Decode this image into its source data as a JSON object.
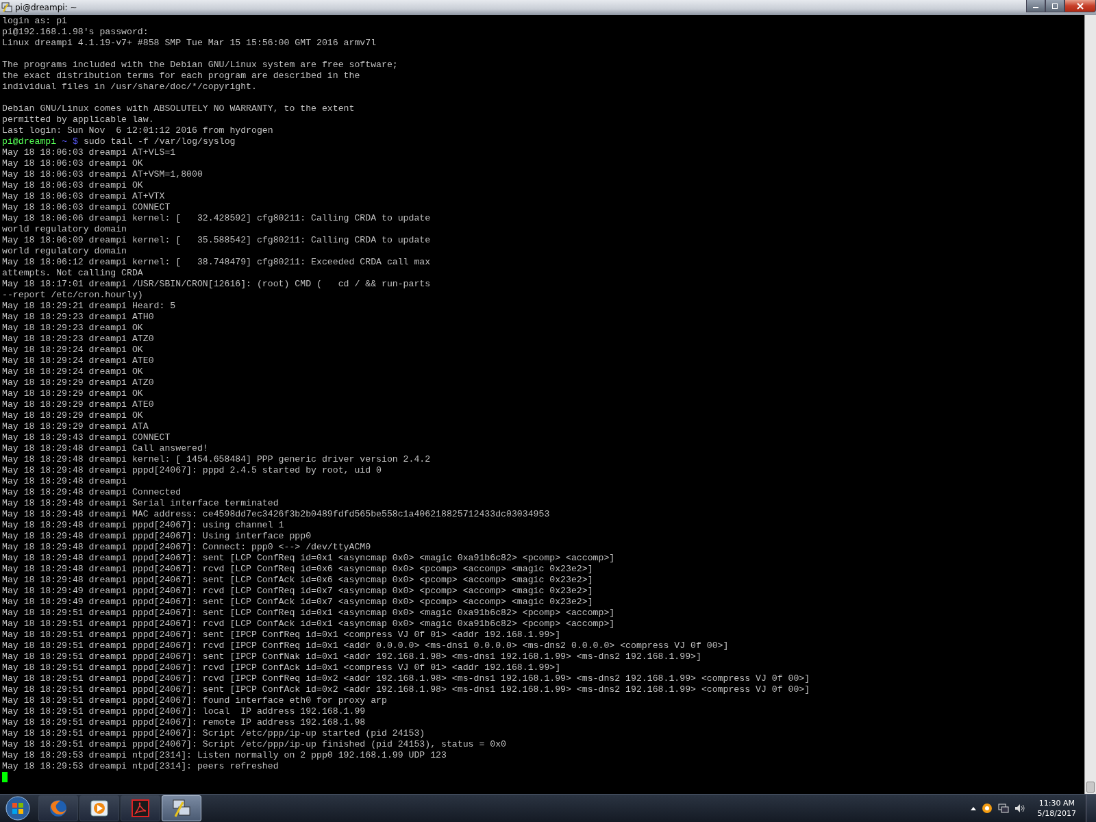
{
  "window": {
    "title": "pi@dreampi: ~"
  },
  "terminal": {
    "blocks": [
      {
        "lines": [
          {
            "kind": "output",
            "text": "login as: pi"
          },
          {
            "kind": "output",
            "text": "pi@192.168.1.98's password:"
          },
          {
            "kind": "output",
            "text": "Linux dreampi 4.1.19-v7+ #858 SMP Tue Mar 15 15:56:00 GMT 2016 armv7l"
          }
        ]
      },
      {
        "lines": [
          {
            "kind": "output",
            "text": "The programs included with the Debian GNU/Linux system are free software;"
          },
          {
            "kind": "output",
            "text": "the exact distribution terms for each program are described in the"
          },
          {
            "kind": "output",
            "text": "individual files in /usr/share/doc/*/copyright."
          }
        ]
      },
      {
        "lines": [
          {
            "kind": "output",
            "text": "Debian GNU/Linux comes with ABSOLUTELY NO WARRANTY, to the extent"
          },
          {
            "kind": "output",
            "text": "permitted by applicable law."
          },
          {
            "kind": "output",
            "text": "Last login: Sun Nov  6 12:01:12 2016 from hydrogen"
          },
          {
            "kind": "prompt",
            "user": "pi@dreampi",
            "path": "~ $",
            "text": "sudo tail -f /var/log/syslog"
          },
          {
            "kind": "output",
            "text": "May 18 18:06:03 dreampi AT+VLS=1"
          },
          {
            "kind": "output",
            "text": "May 18 18:06:03 dreampi OK"
          },
          {
            "kind": "output",
            "text": "May 18 18:06:03 dreampi AT+VSM=1,8000"
          },
          {
            "kind": "output",
            "text": "May 18 18:06:03 dreampi OK"
          },
          {
            "kind": "output",
            "text": "May 18 18:06:03 dreampi AT+VTX"
          },
          {
            "kind": "output",
            "text": "May 18 18:06:03 dreampi CONNECT"
          },
          {
            "kind": "output",
            "text": "May 18 18:06:06 dreampi kernel: [   32.428592] cfg80211: Calling CRDA to update"
          },
          {
            "kind": "output",
            "text": "world regulatory domain"
          },
          {
            "kind": "output",
            "text": "May 18 18:06:09 dreampi kernel: [   35.588542] cfg80211: Calling CRDA to update"
          },
          {
            "kind": "output",
            "text": "world regulatory domain"
          },
          {
            "kind": "output",
            "text": "May 18 18:06:12 dreampi kernel: [   38.748479] cfg80211: Exceeded CRDA call max"
          },
          {
            "kind": "output",
            "text": "attempts. Not calling CRDA"
          },
          {
            "kind": "output",
            "text": "May 18 18:17:01 dreampi /USR/SBIN/CRON[12616]: (root) CMD (   cd / && run-parts"
          },
          {
            "kind": "output",
            "text": "--report /etc/cron.hourly)"
          },
          {
            "kind": "output",
            "text": "May 18 18:29:21 dreampi Heard: 5"
          },
          {
            "kind": "output",
            "text": "May 18 18:29:23 dreampi ATH0"
          },
          {
            "kind": "output",
            "text": "May 18 18:29:23 dreampi OK"
          },
          {
            "kind": "output",
            "text": "May 18 18:29:23 dreampi ATZ0"
          },
          {
            "kind": "output",
            "text": "May 18 18:29:24 dreampi OK"
          },
          {
            "kind": "output",
            "text": "May 18 18:29:24 dreampi ATE0"
          },
          {
            "kind": "output",
            "text": "May 18 18:29:24 dreampi OK"
          },
          {
            "kind": "output",
            "text": "May 18 18:29:29 dreampi ATZ0"
          },
          {
            "kind": "output",
            "text": "May 18 18:29:29 dreampi OK"
          },
          {
            "kind": "output",
            "text": "May 18 18:29:29 dreampi ATE0"
          },
          {
            "kind": "output",
            "text": "May 18 18:29:29 dreampi OK"
          },
          {
            "kind": "output",
            "text": "May 18 18:29:29 dreampi ATA"
          },
          {
            "kind": "output",
            "text": "May 18 18:29:43 dreampi CONNECT"
          },
          {
            "kind": "output",
            "text": "May 18 18:29:48 dreampi Call answered!"
          },
          {
            "kind": "output",
            "text": "May 18 18:29:48 dreampi kernel: [ 1454.658484] PPP generic driver version 2.4.2"
          },
          {
            "kind": "output",
            "text": "May 18 18:29:48 dreampi pppd[24067]: pppd 2.4.5 started by root, uid 0"
          },
          {
            "kind": "output",
            "text": "May 18 18:29:48 dreampi"
          },
          {
            "kind": "output",
            "text": "May 18 18:29:48 dreampi Connected"
          },
          {
            "kind": "output",
            "text": "May 18 18:29:48 dreampi Serial interface terminated"
          },
          {
            "kind": "output",
            "text": "May 18 18:29:48 dreampi MAC address: ce4598dd7ec3426f3b2b0489fdfd565be558c1a406218825712433dc03034953"
          },
          {
            "kind": "output",
            "text": "May 18 18:29:48 dreampi pppd[24067]: using channel 1"
          },
          {
            "kind": "output",
            "text": "May 18 18:29:48 dreampi pppd[24067]: Using interface ppp0"
          },
          {
            "kind": "output",
            "text": "May 18 18:29:48 dreampi pppd[24067]: Connect: ppp0 <--> /dev/ttyACM0"
          },
          {
            "kind": "output",
            "text": "May 18 18:29:48 dreampi pppd[24067]: sent [LCP ConfReq id=0x1 <asyncmap 0x0> <magic 0xa91b6c82> <pcomp> <accomp>]"
          },
          {
            "kind": "output",
            "text": "May 18 18:29:48 dreampi pppd[24067]: rcvd [LCP ConfReq id=0x6 <asyncmap 0x0> <pcomp> <accomp> <magic 0x23e2>]"
          },
          {
            "kind": "output",
            "text": "May 18 18:29:48 dreampi pppd[24067]: sent [LCP ConfAck id=0x6 <asyncmap 0x0> <pcomp> <accomp> <magic 0x23e2>]"
          },
          {
            "kind": "output",
            "text": "May 18 18:29:49 dreampi pppd[24067]: rcvd [LCP ConfReq id=0x7 <asyncmap 0x0> <pcomp> <accomp> <magic 0x23e2>]"
          },
          {
            "kind": "output",
            "text": "May 18 18:29:49 dreampi pppd[24067]: sent [LCP ConfAck id=0x7 <asyncmap 0x0> <pcomp> <accomp> <magic 0x23e2>]"
          },
          {
            "kind": "output",
            "text": "May 18 18:29:51 dreampi pppd[24067]: sent [LCP ConfReq id=0x1 <asyncmap 0x0> <magic 0xa91b6c82> <pcomp> <accomp>]"
          },
          {
            "kind": "output",
            "text": "May 18 18:29:51 dreampi pppd[24067]: rcvd [LCP ConfAck id=0x1 <asyncmap 0x0> <magic 0xa91b6c82> <pcomp> <accomp>]"
          },
          {
            "kind": "output",
            "text": "May 18 18:29:51 dreampi pppd[24067]: sent [IPCP ConfReq id=0x1 <compress VJ 0f 01> <addr 192.168.1.99>]"
          },
          {
            "kind": "output",
            "text": "May 18 18:29:51 dreampi pppd[24067]: rcvd [IPCP ConfReq id=0x1 <addr 0.0.0.0> <ms-dns1 0.0.0.0> <ms-dns2 0.0.0.0> <compress VJ 0f 00>]"
          },
          {
            "kind": "output",
            "text": "May 18 18:29:51 dreampi pppd[24067]: sent [IPCP ConfNak id=0x1 <addr 192.168.1.98> <ms-dns1 192.168.1.99> <ms-dns2 192.168.1.99>]"
          },
          {
            "kind": "output",
            "text": "May 18 18:29:51 dreampi pppd[24067]: rcvd [IPCP ConfAck id=0x1 <compress VJ 0f 01> <addr 192.168.1.99>]"
          },
          {
            "kind": "output",
            "text": "May 18 18:29:51 dreampi pppd[24067]: rcvd [IPCP ConfReq id=0x2 <addr 192.168.1.98> <ms-dns1 192.168.1.99> <ms-dns2 192.168.1.99> <compress VJ 0f 00>]"
          },
          {
            "kind": "output",
            "text": "May 18 18:29:51 dreampi pppd[24067]: sent [IPCP ConfAck id=0x2 <addr 192.168.1.98> <ms-dns1 192.168.1.99> <ms-dns2 192.168.1.99> <compress VJ 0f 00>]"
          },
          {
            "kind": "output",
            "text": "May 18 18:29:51 dreampi pppd[24067]: found interface eth0 for proxy arp"
          },
          {
            "kind": "output",
            "text": "May 18 18:29:51 dreampi pppd[24067]: local  IP address 192.168.1.99"
          },
          {
            "kind": "output",
            "text": "May 18 18:29:51 dreampi pppd[24067]: remote IP address 192.168.1.98"
          },
          {
            "kind": "output",
            "text": "May 18 18:29:51 dreampi pppd[24067]: Script /etc/ppp/ip-up started (pid 24153)"
          },
          {
            "kind": "output",
            "text": "May 18 18:29:51 dreampi pppd[24067]: Script /etc/ppp/ip-up finished (pid 24153), status = 0x0"
          },
          {
            "kind": "output",
            "text": "May 18 18:29:53 dreampi ntpd[2314]: Listen normally on 2 ppp0 192.168.1.99 UDP 123"
          },
          {
            "kind": "output",
            "text": "May 18 18:29:53 dreampi ntpd[2314]: peers refreshed"
          }
        ]
      }
    ]
  },
  "taskbar": {
    "apps": [
      {
        "kind": "browser",
        "selected": false
      },
      {
        "kind": "media",
        "selected": false
      },
      {
        "kind": "pdf",
        "selected": false
      },
      {
        "kind": "terminal",
        "selected": true
      }
    ],
    "clock": {
      "time": "11:30 AM",
      "date": "5/18/2017"
    }
  }
}
